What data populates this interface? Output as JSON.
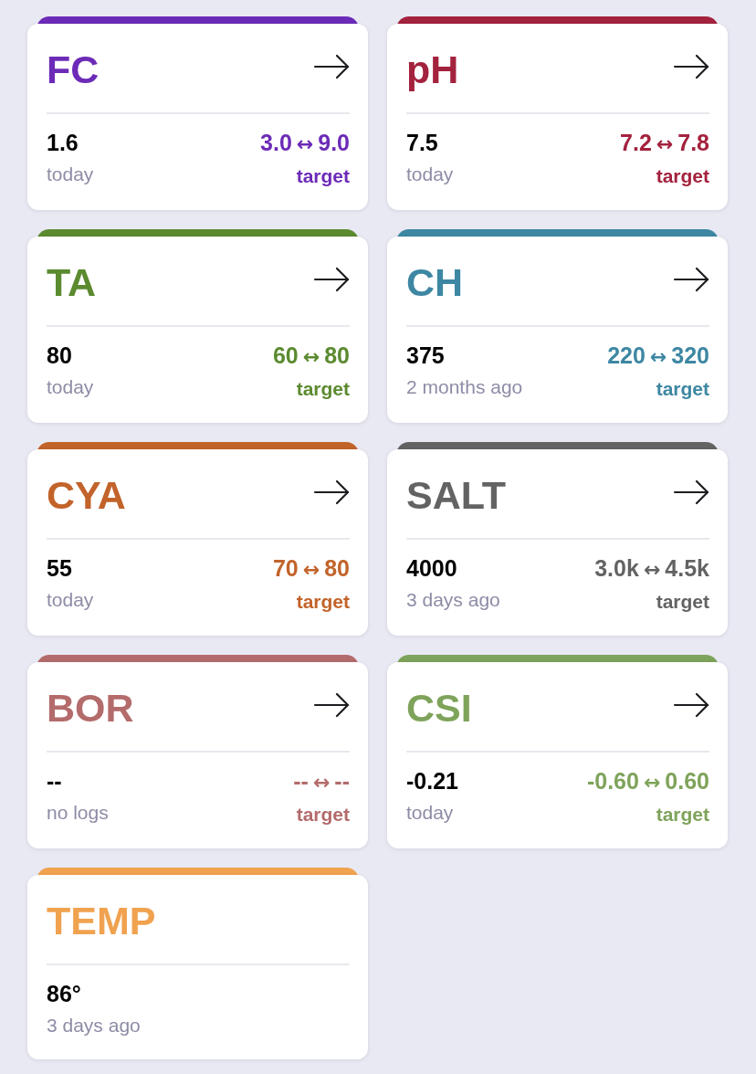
{
  "cards": [
    {
      "title": "FC",
      "color": "#6c2bb7",
      "arrow": true,
      "reading": "1.6",
      "when": "today",
      "target": {
        "low": "3.0",
        "separator": "↔",
        "high": "9.0",
        "label": "target"
      }
    },
    {
      "title": "pH",
      "color": "#a3223d",
      "arrow": true,
      "reading": "7.5",
      "when": "today",
      "target": {
        "low": "7.2",
        "separator": "↔",
        "high": "7.8",
        "label": "target"
      }
    },
    {
      "title": "TA",
      "color": "#5b8a2f",
      "arrow": true,
      "reading": "80",
      "when": "today",
      "target": {
        "low": "60",
        "separator": "↔",
        "high": "80",
        "label": "target"
      }
    },
    {
      "title": "CH",
      "color": "#3d87a3",
      "arrow": true,
      "reading": "375",
      "when": "2 months ago",
      "target": {
        "low": "220",
        "separator": "↔",
        "high": "320",
        "label": "target"
      }
    },
    {
      "title": "CYA",
      "color": "#c2632a",
      "arrow": true,
      "reading": "55",
      "when": "today",
      "target": {
        "low": "70",
        "separator": "↔",
        "high": "80",
        "label": "target"
      }
    },
    {
      "title": "SALT",
      "color": "#636363",
      "arrow": true,
      "reading": "4000",
      "when": "3 days ago",
      "target": {
        "low": "3.0k",
        "separator": "↔",
        "high": "4.5k",
        "label": "target"
      }
    },
    {
      "title": "BOR",
      "color": "#b46b6b",
      "arrow": true,
      "reading": "--",
      "when": "no logs",
      "target": {
        "low": "--",
        "separator": "↔",
        "high": "--",
        "label": "target"
      }
    },
    {
      "title": "CSI",
      "color": "#7ea35a",
      "arrow": true,
      "reading": "-0.21",
      "when": "today",
      "target": {
        "low": "-0.60",
        "separator": "↔",
        "high": "0.60",
        "label": "target"
      }
    },
    {
      "title": "TEMP",
      "color": "#f0a24f",
      "arrow": false,
      "reading": "86°",
      "when": "3 days ago"
    }
  ]
}
